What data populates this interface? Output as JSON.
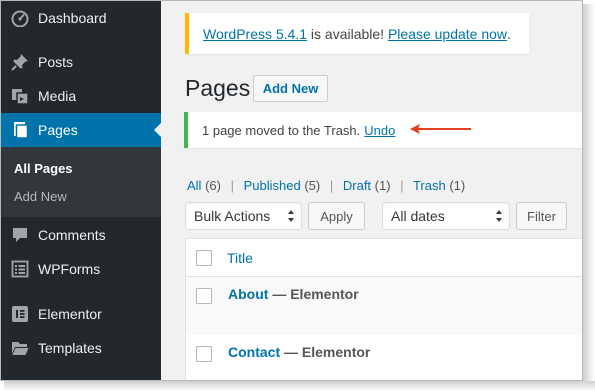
{
  "sidebar": {
    "items": [
      {
        "label": "Dashboard",
        "icon": "dashboard-icon"
      },
      {
        "label": "Posts",
        "icon": "pin-icon"
      },
      {
        "label": "Media",
        "icon": "media-icon"
      },
      {
        "label": "Pages",
        "icon": "pages-icon"
      },
      {
        "label": "Comments",
        "icon": "comment-icon"
      },
      {
        "label": "WPForms",
        "icon": "forms-icon"
      },
      {
        "label": "Elementor",
        "icon": "elementor-icon"
      },
      {
        "label": "Templates",
        "icon": "folder-icon"
      }
    ],
    "submenu": [
      {
        "label": "All Pages"
      },
      {
        "label": "Add New"
      }
    ]
  },
  "notice_update": {
    "link1": "WordPress 5.4.1",
    "middle": " is available! ",
    "link2": "Please update now",
    "end": "."
  },
  "header": {
    "title": "Pages",
    "add_new": "Add New"
  },
  "notice_trash": {
    "message": "1 page moved to the Trash.",
    "undo": "Undo"
  },
  "filters": [
    {
      "label": "All",
      "count": "(6)"
    },
    {
      "label": "Published",
      "count": "(5)"
    },
    {
      "label": "Draft",
      "count": "(1)"
    },
    {
      "label": "Trash",
      "count": "(1)"
    }
  ],
  "toolbar": {
    "bulk_actions": "Bulk Actions",
    "apply": "Apply",
    "dates": "All dates",
    "filter": "Filter"
  },
  "table": {
    "column_title": "Title",
    "rows": [
      {
        "title": "About",
        "state": " — Elementor"
      },
      {
        "title": "Contact",
        "state": " — Elementor"
      }
    ]
  },
  "colors": {
    "sidebar_bg": "#23282d",
    "active_bg": "#0073aa",
    "link": "#0073aa",
    "update_notice_border": "#ffb900",
    "success_notice_border": "#46b450",
    "annotation_arrow": "#e2401c"
  }
}
